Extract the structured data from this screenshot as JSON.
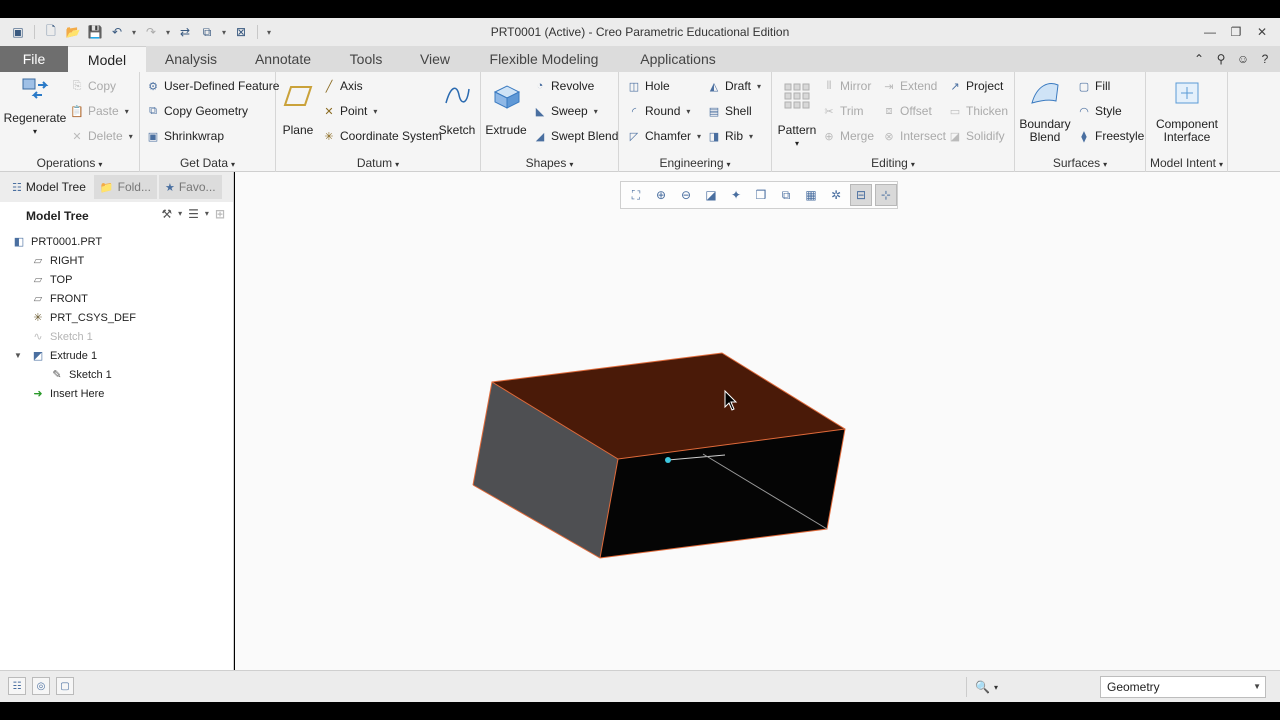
{
  "window": {
    "title": "PRT0001 (Active) - Creo Parametric Educational Edition",
    "controls": [
      "minimize-icon",
      "restore-icon",
      "close-icon"
    ]
  },
  "quick_access": [
    "new-icon",
    "open-icon",
    "save-icon",
    "undo-icon",
    "redo-icon",
    "regenerate-icon",
    "windows-icon",
    "close-window-icon",
    "customize-icon"
  ],
  "tabs": [
    {
      "label": "File"
    },
    {
      "label": "Model"
    },
    {
      "label": "Analysis"
    },
    {
      "label": "Annotate"
    },
    {
      "label": "Tools"
    },
    {
      "label": "View"
    },
    {
      "label": "Flexible Modeling"
    },
    {
      "label": "Applications"
    }
  ],
  "ribbon": {
    "operations": {
      "label": "Operations",
      "regenerate": "Regenerate",
      "copy": "Copy",
      "paste": "Paste",
      "delete": "Delete"
    },
    "get_data": {
      "label": "Get Data",
      "udf": "User-Defined Feature",
      "copy_geometry": "Copy Geometry",
      "shrinkwrap": "Shrinkwrap"
    },
    "datum": {
      "label": "Datum",
      "plane": "Plane",
      "axis": "Axis",
      "point": "Point",
      "csys": "Coordinate System",
      "sketch": "Sketch"
    },
    "shapes": {
      "label": "Shapes",
      "extrude": "Extrude",
      "revolve": "Revolve",
      "sweep": "Sweep",
      "swept_blend": "Swept Blend"
    },
    "engineering": {
      "label": "Engineering",
      "hole": "Hole",
      "round": "Round",
      "chamfer": "Chamfer",
      "draft": "Draft",
      "shell": "Shell",
      "rib": "Rib"
    },
    "editing": {
      "label": "Editing",
      "pattern": "Pattern",
      "mirror": "Mirror",
      "trim": "Trim",
      "merge": "Merge",
      "extend": "Extend",
      "offset": "Offset",
      "intersect": "Intersect",
      "project": "Project",
      "thicken": "Thicken",
      "solidify": "Solidify"
    },
    "surfaces": {
      "label": "Surfaces",
      "boundary_blend_1": "Boundary",
      "boundary_blend_2": "Blend",
      "fill": "Fill",
      "style": "Style",
      "freestyle": "Freestyle"
    },
    "model_intent": {
      "label": "Model Intent",
      "component_interface_1": "Component",
      "component_interface_2": "Interface"
    }
  },
  "panel": {
    "tabs": [
      "Model Tree",
      "Fold...",
      "Favo..."
    ],
    "header": "Model Tree",
    "tree": [
      {
        "label": "PRT0001.PRT",
        "icon": "part-icon"
      },
      {
        "label": "RIGHT",
        "icon": "datum-plane-icon"
      },
      {
        "label": "TOP",
        "icon": "datum-plane-icon"
      },
      {
        "label": "FRONT",
        "icon": "datum-plane-icon"
      },
      {
        "label": "PRT_CSYS_DEF",
        "icon": "csys-icon"
      },
      {
        "label": "Sketch 1",
        "icon": "sketch-icon",
        "hidden": true
      },
      {
        "label": "Extrude 1",
        "icon": "extrude-icon"
      },
      {
        "label": "Sketch 1",
        "icon": "sketch-icon"
      },
      {
        "label": "Insert Here",
        "icon": "insert-arrow-icon"
      }
    ]
  },
  "status": {
    "filter_value": "Geometry"
  },
  "colors": {
    "top_face": "#4a1a08",
    "side_left": "#4e4f52",
    "side_front": "#050505",
    "edge_highlight": "#e06a3a"
  }
}
